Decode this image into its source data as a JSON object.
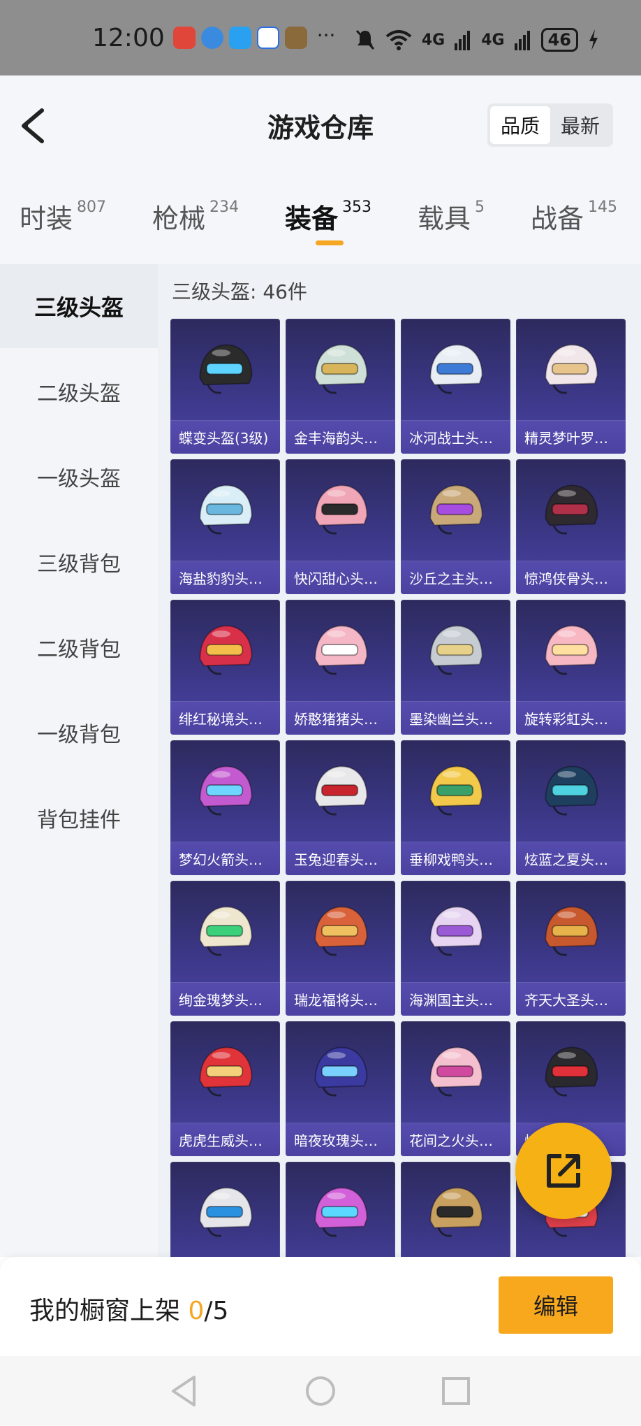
{
  "status_bar": {
    "time": "12:00",
    "dots": "···",
    "signal_1": "4G",
    "signal_2": "4G",
    "battery": "46"
  },
  "header": {
    "title": "游戏仓库",
    "sort_options": [
      "品质",
      "最新"
    ]
  },
  "tabs": [
    {
      "label": "时装",
      "count": "807"
    },
    {
      "label": "枪械",
      "count": "234"
    },
    {
      "label": "装备",
      "count": "353"
    },
    {
      "label": "载具",
      "count": "5"
    },
    {
      "label": "战备",
      "count": "145"
    }
  ],
  "sidebar": {
    "items": [
      "三级头盔",
      "二级头盔",
      "一级头盔",
      "三级背包",
      "二级背包",
      "一级背包",
      "背包挂件"
    ]
  },
  "section": {
    "title": "三级头盔: 46件"
  },
  "items": [
    {
      "name": "蝶变头盔(3级)",
      "color": "#2b2b2b",
      "accent": "#5fd3ff"
    },
    {
      "name": "金丰海韵头…",
      "color": "#cfe0d8",
      "accent": "#d8b45a"
    },
    {
      "name": "冰河战士头…",
      "color": "#e9eef5",
      "accent": "#3d7bd6"
    },
    {
      "name": "精灵梦叶罗…",
      "color": "#f1e6ea",
      "accent": "#e7c48c"
    },
    {
      "name": "海盐豹豹头…",
      "color": "#d9eef6",
      "accent": "#6ab7e0"
    },
    {
      "name": "快闪甜心头…",
      "color": "#f0a6b6",
      "accent": "#2b2b2b"
    },
    {
      "name": "沙丘之主头…",
      "color": "#c9a97a",
      "accent": "#a64ce0"
    },
    {
      "name": "惊鸿侠骨头…",
      "color": "#2e2a30",
      "accent": "#b0304a"
    },
    {
      "name": "绯红秘境头…",
      "color": "#d9304a",
      "accent": "#f2c04a"
    },
    {
      "name": "娇憨猪猪头…",
      "color": "#f5b7c6",
      "accent": "#ffffff"
    },
    {
      "name": "墨染幽兰头…",
      "color": "#c7ccd3",
      "accent": "#e7d08a"
    },
    {
      "name": "旋转彩虹头…",
      "color": "#f7b8c4",
      "accent": "#ffe0a0"
    },
    {
      "name": "梦幻火箭头…",
      "color": "#c45ad0",
      "accent": "#6fd7ff"
    },
    {
      "name": "玉兔迎春头…",
      "color": "#e8e8ea",
      "accent": "#c8242e"
    },
    {
      "name": "垂柳戏鸭头…",
      "color": "#f2c94a",
      "accent": "#3aa06a"
    },
    {
      "name": "炫蓝之夏头…",
      "color": "#1f3f5f",
      "accent": "#4fd3e0"
    },
    {
      "name": "绚金瑰梦头…",
      "color": "#efe6cf",
      "accent": "#3cd07a"
    },
    {
      "name": "瑞龙福将头…",
      "color": "#d9623a",
      "accent": "#f0c060"
    },
    {
      "name": "海渊国主头…",
      "color": "#e6d4f2",
      "accent": "#9a5ad6"
    },
    {
      "name": "齐天大圣头…",
      "color": "#c8582e",
      "accent": "#e8b24a"
    },
    {
      "name": "虎虎生威头…",
      "color": "#e0343a",
      "accent": "#f4d07a"
    },
    {
      "name": "暗夜玫瑰头…",
      "color": "#3a3aa0",
      "accent": "#7ad0ff"
    },
    {
      "name": "花间之火头…",
      "color": "#f4c0d0",
      "accent": "#d04aa0"
    },
    {
      "name": "焰…头…",
      "color": "#2a2a2e",
      "accent": "#e0303a"
    },
    {
      "name": "",
      "color": "#e6e6ea",
      "accent": "#2a90e0"
    },
    {
      "name": "",
      "color": "#d260d8",
      "accent": "#5ad8ff"
    },
    {
      "name": "",
      "color": "#c8a060",
      "accent": "#2a2a2a"
    },
    {
      "name": "",
      "color": "#e0404a",
      "accent": "#ffffff"
    }
  ],
  "footer": {
    "shelf_label": "我的橱窗上架 ",
    "shelf_current": "0",
    "shelf_total": "/5",
    "edit_label": "编辑"
  },
  "colors": {
    "accent": "#f5a623",
    "card_bg": "#3a3683"
  }
}
